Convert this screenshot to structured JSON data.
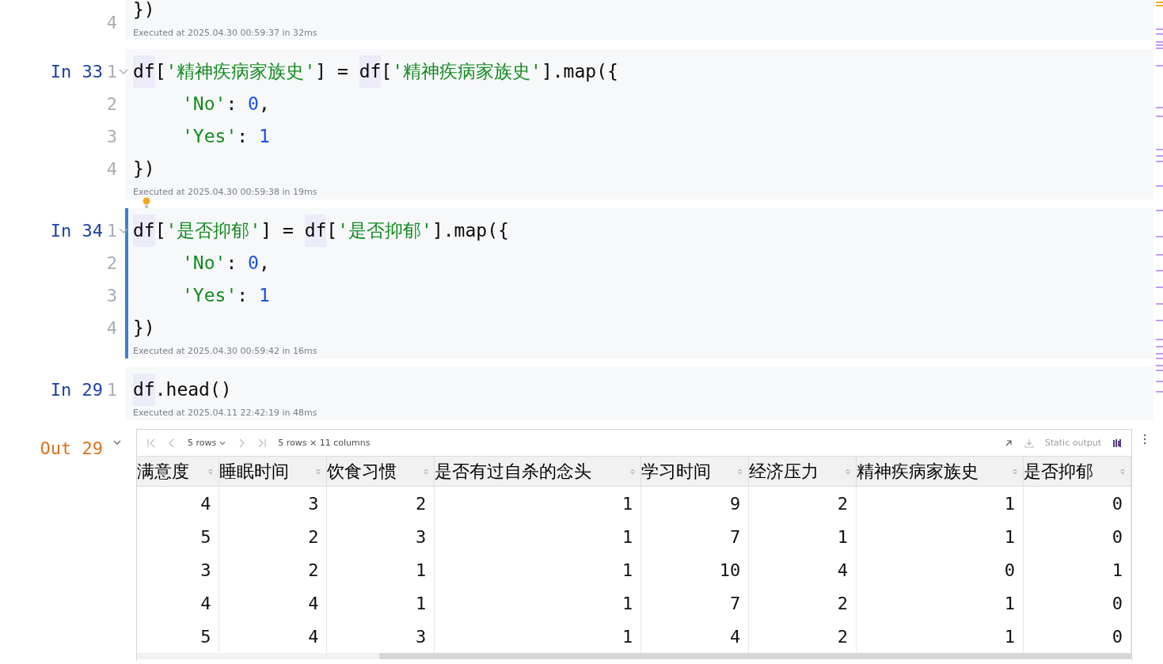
{
  "cells": [
    {
      "selected": false,
      "lines": [
        {
          "number": "4",
          "fold": false,
          "tokens": [
            {
              "kind": "punct",
              "text": "})"
            }
          ]
        }
      ],
      "executed": "Executed at 2025.04.30 00:59:37 in 32ms"
    },
    {
      "prompt": "In 33",
      "selected": false,
      "lines": [
        {
          "number": "1",
          "fold": true,
          "tokens": [
            {
              "kind": "var",
              "text": "df"
            },
            {
              "kind": "punct",
              "text": "["
            },
            {
              "kind": "str",
              "text": "'精神疾病家族史'"
            },
            {
              "kind": "punct",
              "text": "] = "
            },
            {
              "kind": "var",
              "text": "df"
            },
            {
              "kind": "punct",
              "text": "["
            },
            {
              "kind": "str",
              "text": "'精神疾病家族史'"
            },
            {
              "kind": "punct",
              "text": "].map({"
            }
          ]
        },
        {
          "number": "2",
          "fold": false,
          "indent": true,
          "tokens": [
            {
              "kind": "str",
              "text": "'No'"
            },
            {
              "kind": "punct",
              "text": ": "
            },
            {
              "kind": "num",
              "text": "0"
            },
            {
              "kind": "punct",
              "text": ","
            }
          ]
        },
        {
          "number": "3",
          "fold": false,
          "indent": true,
          "tokens": [
            {
              "kind": "str",
              "text": "'Yes'"
            },
            {
              "kind": "punct",
              "text": ": "
            },
            {
              "kind": "num",
              "text": "1"
            }
          ]
        },
        {
          "number": "4",
          "fold": false,
          "tokens": [
            {
              "kind": "punct",
              "text": "})"
            }
          ]
        }
      ],
      "executed": "Executed at 2025.04.30 00:59:38 in 19ms"
    },
    {
      "prompt": "In 34",
      "selected": true,
      "lines": [
        {
          "number": "1",
          "fold": true,
          "tokens": [
            {
              "kind": "var",
              "text": "df"
            },
            {
              "kind": "punct",
              "text": "["
            },
            {
              "kind": "str",
              "text": "'是否抑郁'"
            },
            {
              "kind": "punct",
              "text": "] = "
            },
            {
              "kind": "var",
              "text": "df"
            },
            {
              "kind": "punct",
              "text": "["
            },
            {
              "kind": "str",
              "text": "'是否抑郁'"
            },
            {
              "kind": "punct",
              "text": "].map({"
            }
          ]
        },
        {
          "number": "2",
          "fold": false,
          "indent": true,
          "tokens": [
            {
              "kind": "str",
              "text": "'No'"
            },
            {
              "kind": "punct",
              "text": ": "
            },
            {
              "kind": "num",
              "text": "0"
            },
            {
              "kind": "punct",
              "text": ","
            }
          ]
        },
        {
          "number": "3",
          "fold": false,
          "indent": true,
          "tokens": [
            {
              "kind": "str",
              "text": "'Yes'"
            },
            {
              "kind": "punct",
              "text": ": "
            },
            {
              "kind": "num",
              "text": "1"
            }
          ]
        },
        {
          "number": "4",
          "fold": false,
          "tokens": [
            {
              "kind": "punct",
              "text": "})"
            }
          ]
        }
      ],
      "executed": "Executed at 2025.04.30 00:59:42 in 16ms"
    },
    {
      "prompt": "In 29",
      "selected": false,
      "lines": [
        {
          "number": "1",
          "fold": false,
          "tokens": [
            {
              "kind": "var",
              "text": "df"
            },
            {
              "kind": "punct",
              "text": ".head()"
            }
          ]
        }
      ],
      "executed": "Executed at 2025.04.11 22:42:19 in 48ms"
    }
  ],
  "output": {
    "prompt": "Out 29",
    "toolbar": {
      "rows": "5 rows",
      "shape": "5 rows × 11 columns",
      "mode": "Static output"
    },
    "columns": [
      "满意度",
      "睡眠时间",
      "饮食习惯",
      "是否有过自杀的念头",
      "学习时间",
      "经济压力",
      "精神疾病家族史",
      "是否抑郁"
    ],
    "rows": [
      [
        "4",
        "3",
        "2",
        "1",
        "9",
        "2",
        "1",
        "0"
      ],
      [
        "5",
        "2",
        "3",
        "1",
        "7",
        "1",
        "1",
        "0"
      ],
      [
        "3",
        "2",
        "1",
        "1",
        "10",
        "4",
        "0",
        "1"
      ],
      [
        "4",
        "4",
        "1",
        "1",
        "7",
        "2",
        "1",
        "0"
      ],
      [
        "5",
        "4",
        "3",
        "1",
        "4",
        "2",
        "1",
        "0"
      ]
    ]
  }
}
